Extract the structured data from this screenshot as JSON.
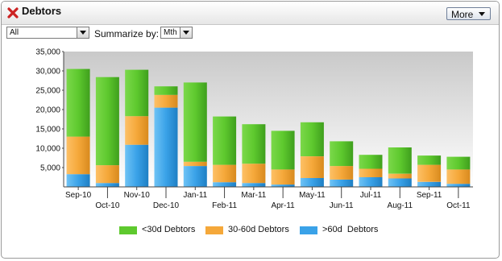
{
  "window": {
    "title": "Debtors",
    "more_label": "More"
  },
  "filters": {
    "category_value": "All",
    "summarize_label": "Summarize by:",
    "summarize_value": "Mth"
  },
  "colors": {
    "lt30": "#5ec92e",
    "d30_60": "#f5a83a",
    "gt60": "#3aa2e8",
    "close": "#cc2222"
  },
  "chart_data": {
    "type": "bar",
    "stacked": true,
    "categories": [
      "Sep-10",
      "Oct-10",
      "Nov-10",
      "Dec-10",
      "Jan-11",
      "Feb-11",
      "Mar-11",
      "Apr-11",
      "May-11",
      "Jun-11",
      "Jul-11",
      "Aug-11",
      "Sep-11",
      "Oct-11"
    ],
    "series": [
      {
        "name": ">60d  Debtors",
        "values": [
          3300,
          1000,
          10900,
          20500,
          5400,
          1200,
          1000,
          600,
          2300,
          1900,
          2500,
          2200,
          1300,
          800
        ]
      },
      {
        "name": "30-60d Debtors",
        "values": [
          9700,
          4600,
          7400,
          3300,
          1100,
          4500,
          5000,
          3900,
          5600,
          3500,
          2200,
          1200,
          4400,
          3700
        ]
      },
      {
        "name": "<30d Debtors",
        "values": [
          17500,
          22800,
          12000,
          2200,
          20500,
          12500,
          10200,
          10000,
          8800,
          6400,
          3600,
          6800,
          2400,
          3300
        ]
      }
    ],
    "yticks": [
      "5,000",
      "10,000",
      "15,000",
      "20,000",
      "25,000",
      "30,000",
      "35,000"
    ],
    "ylim": [
      0,
      35000
    ],
    "legend_position": "bottom",
    "grid": false
  }
}
